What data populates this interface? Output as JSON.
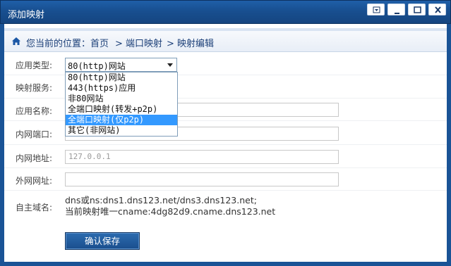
{
  "window": {
    "title": "添加映射",
    "buttons": [
      "dropdown",
      "restore",
      "minimize",
      "close"
    ]
  },
  "breadcrumb": {
    "prefix": "您当前的位置：",
    "items": [
      "首页",
      "> 端口映射",
      "> 映射编辑"
    ]
  },
  "form": {
    "app_type": {
      "label": "应用类型:",
      "value": "80(http)网站",
      "options": [
        "80(http)网站",
        "443(https)应用",
        "非80网站",
        "全端口映射(转发+p2p)",
        "全端口映射(仅p2p)",
        "其它(非网站)"
      ],
      "highlighted_index": 4
    },
    "mapping_service": {
      "label": "映射服务:"
    },
    "app_name": {
      "label": "应用名称:",
      "value": ""
    },
    "lan_port": {
      "label": "内网端口:",
      "value": ""
    },
    "lan_address": {
      "label": "内网地址:",
      "placeholder": "127.0.0.1"
    },
    "wan_address": {
      "label": "外网网址:",
      "value": ""
    },
    "custom_domain": {
      "label": "自主域名:",
      "line1": "dns或ns:dns1.dns123.net/dns3.dns123.net;",
      "line2": "当前映射唯一cname:4dg82d9.cname.dns123.net"
    },
    "save_label": "确认保存"
  },
  "colors": {
    "titlebar": "#1a5396",
    "highlight": "#3399ff",
    "link": "#1b3f78"
  }
}
